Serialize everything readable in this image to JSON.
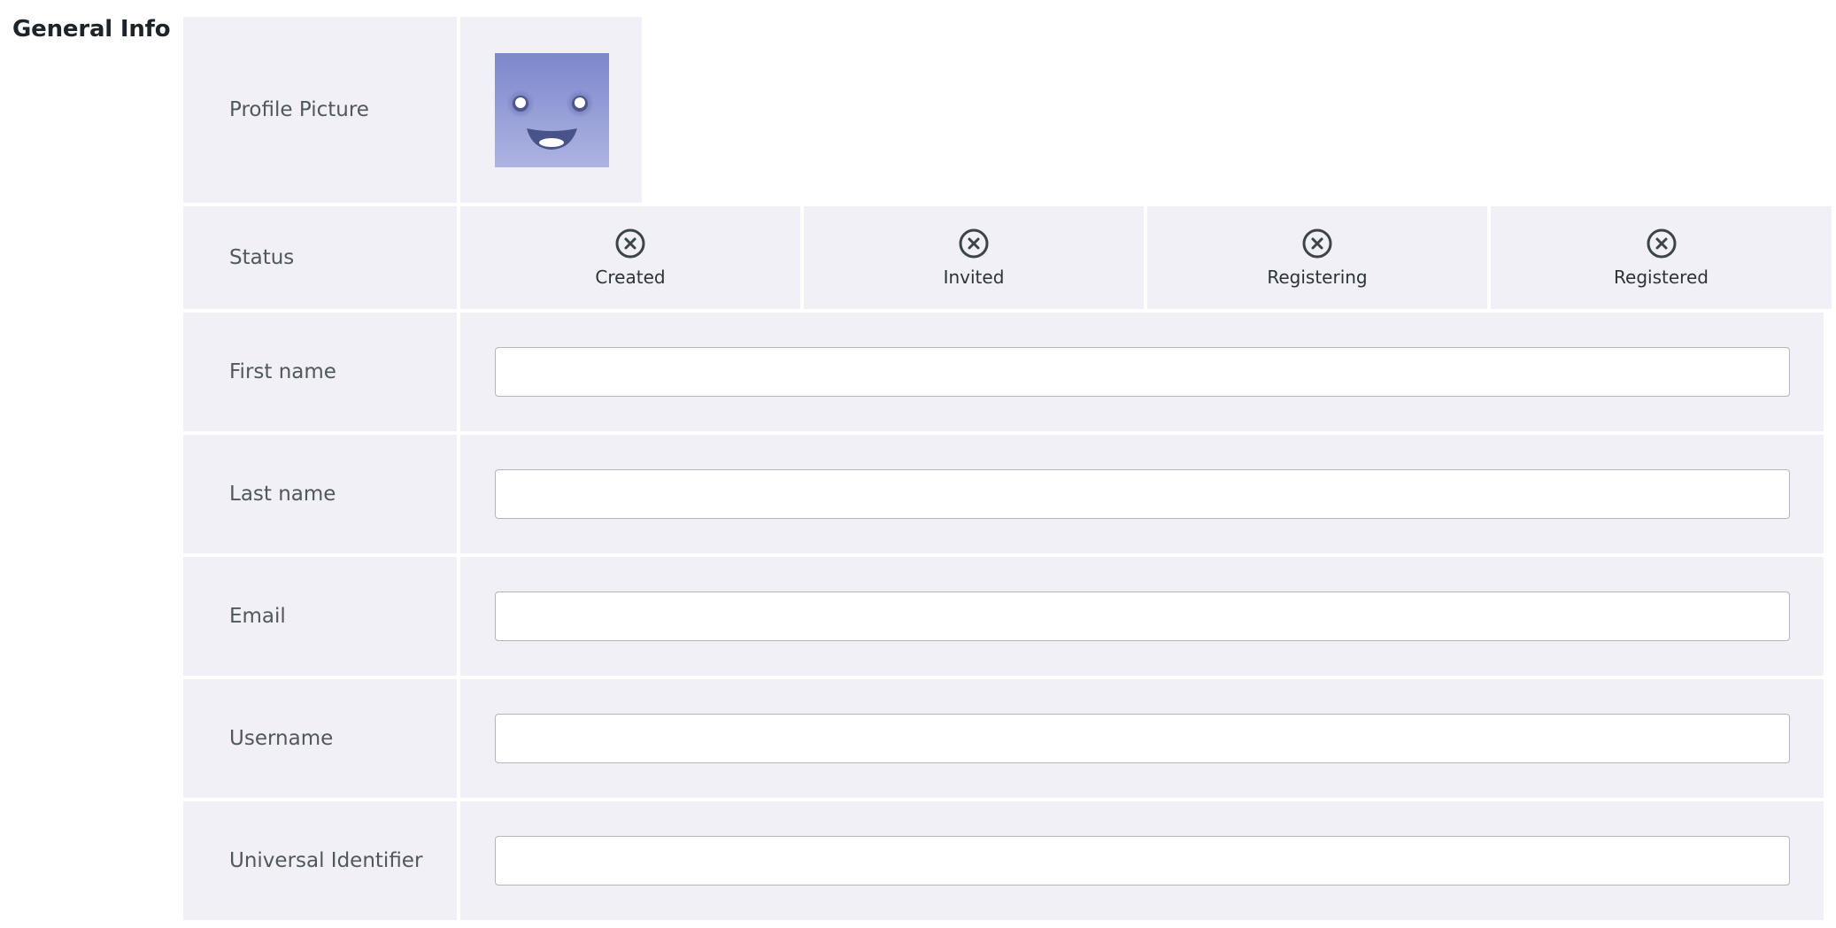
{
  "section": {
    "title": "General Info"
  },
  "profile_picture": {
    "label": "Profile Picture",
    "avatar_icon": "smiling-face-avatar",
    "colors": {
      "top": "#7d87cb",
      "bottom": "#adb4e2"
    }
  },
  "status": {
    "label": "Status",
    "steps": [
      {
        "label": "Created",
        "icon": "x-circle-icon"
      },
      {
        "label": "Invited",
        "icon": "x-circle-icon"
      },
      {
        "label": "Registering",
        "icon": "x-circle-icon"
      },
      {
        "label": "Registered",
        "icon": "x-circle-icon"
      }
    ]
  },
  "fields": [
    {
      "label": "First name",
      "value": "",
      "placeholder": ""
    },
    {
      "label": "Last name",
      "value": "",
      "placeholder": ""
    },
    {
      "label": "Email",
      "value": "",
      "placeholder": ""
    },
    {
      "label": "Username",
      "value": "",
      "placeholder": ""
    },
    {
      "label": "Universal Identifier",
      "value": "",
      "placeholder": ""
    }
  ],
  "colors": {
    "cell_background": "#f0f0f6",
    "icon": "#3c434a"
  }
}
